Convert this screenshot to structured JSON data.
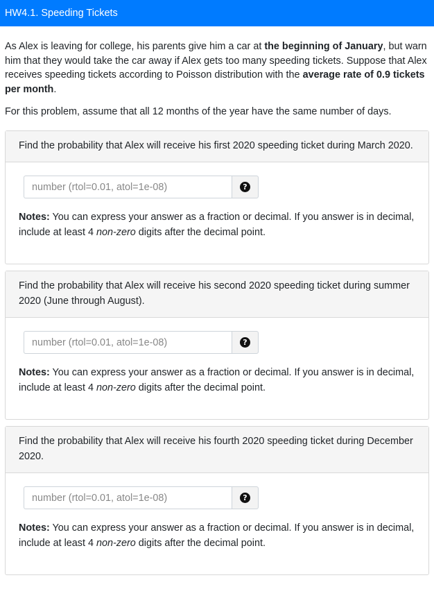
{
  "header": {
    "title": "HW4.1. Speeding Tickets"
  },
  "intro": {
    "p1_a": "As Alex is leaving for college, his parents give him a car at ",
    "p1_b": "the beginning of January",
    "p1_c": ", but warn him that they would take the car away if Alex gets too many speeding tickets. Suppose that Alex receives speeding tickets according to Poisson distribution with the ",
    "p1_d": "average rate of 0.9 tickets per month",
    "p1_e": ".",
    "p2": "For this problem, assume that all 12 months of the year have the same number of days."
  },
  "questions": [
    {
      "prompt": "Find the probability that Alex will receive his first 2020 speeding ticket during March 2020.",
      "placeholder": "number (rtol=0.01, atol=1e-08)",
      "notes_label": "Notes:",
      "notes_a": " You can express your answer as a fraction or decimal. If you answer is in decimal, include at least 4 ",
      "notes_em": "non-zero",
      "notes_b": " digits after the decimal point.",
      "help": "?"
    },
    {
      "prompt": "Find the probability that Alex will receive his second 2020 speeding ticket during summer 2020 (June through August).",
      "placeholder": "number (rtol=0.01, atol=1e-08)",
      "notes_label": "Notes:",
      "notes_a": " You can express your answer as a fraction or decimal. If you answer is in decimal, include at least 4 ",
      "notes_em": "non-zero",
      "notes_b": " digits after the decimal point.",
      "help": "?"
    },
    {
      "prompt": "Find the probability that Alex will receive his fourth 2020 speeding ticket during December 2020.",
      "placeholder": "number (rtol=0.01, atol=1e-08)",
      "notes_label": "Notes:",
      "notes_a": " You can express your answer as a fraction or decimal. If you answer is in decimal, include at least 4 ",
      "notes_em": "non-zero",
      "notes_b": " digits after the decimal point.",
      "help": "?"
    }
  ]
}
